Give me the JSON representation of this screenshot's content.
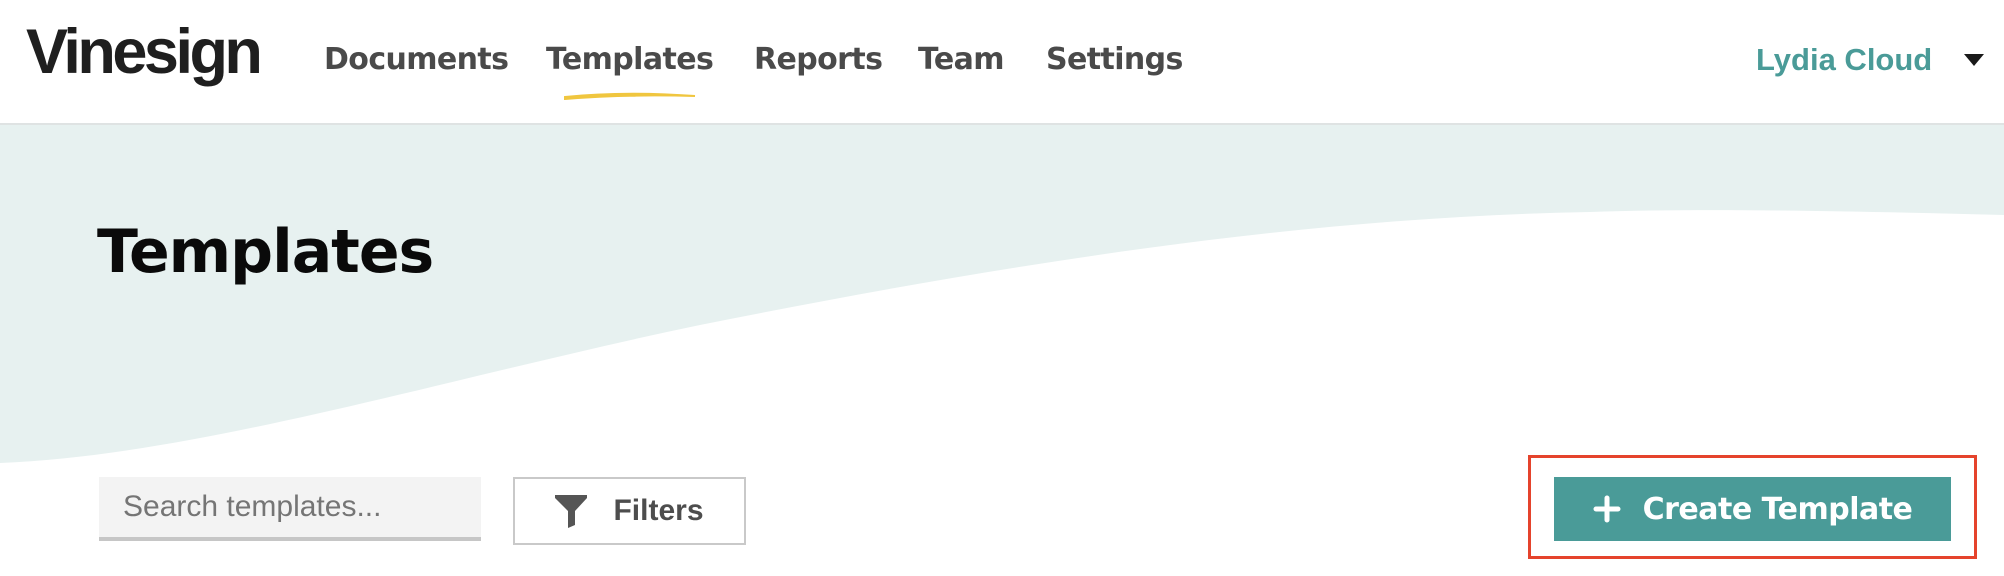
{
  "header": {
    "logo": "Vinesign",
    "nav": [
      {
        "label": "Documents",
        "active": false
      },
      {
        "label": "Templates",
        "active": true
      },
      {
        "label": "Reports",
        "active": false
      },
      {
        "label": "Team",
        "active": false
      },
      {
        "label": "Settings",
        "active": false
      }
    ],
    "user_name": "Lydia Cloud",
    "user_menu_icon": "caret-down-icon"
  },
  "page": {
    "title": "Templates"
  },
  "toolbar": {
    "search_placeholder": "Search templates...",
    "search_value": "",
    "filters_label": "Filters",
    "filters_icon": "filter-funnel-icon",
    "create_label": "Create Template",
    "create_icon": "plus-icon"
  },
  "colors": {
    "brand_teal": "#4a9b98",
    "active_underline": "#f0c63f",
    "hero_background": "#e7f1f0",
    "highlight_outline": "#e5432c"
  }
}
